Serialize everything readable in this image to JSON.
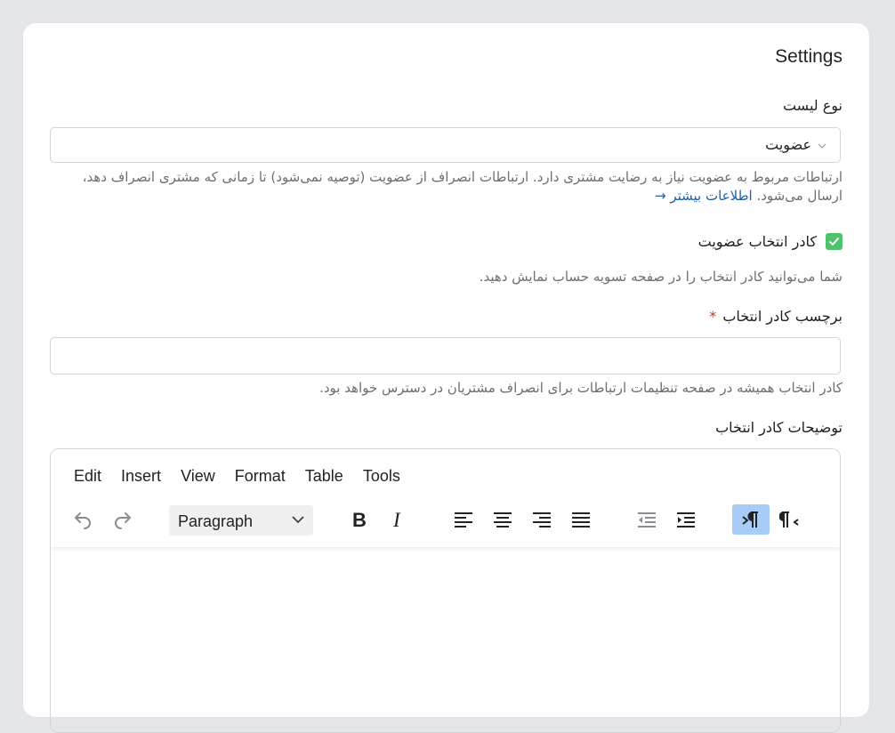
{
  "page": {
    "title": "Settings"
  },
  "list_type": {
    "label": "نوع لیست",
    "selected": "عضویت",
    "help_text": "ارتباطات مربوط به عضویت نیاز به رضایت مشتری دارد. ارتباطات انصراف از عضویت (توصیه نمی‌شود) تا زمانی که مشتری انصراف دهد، ارسال می‌شود.",
    "learn_more": "اطلاعات بیشتر →"
  },
  "opt_in_checkbox": {
    "label": "کادر انتخاب عضویت",
    "checked": true,
    "help_text": "شما می‌توانید کادر انتخاب را در صفحه تسویه حساب نمایش دهید."
  },
  "checkbox_label_field": {
    "label": "برچسب کادر انتخاب",
    "required_mark": "*",
    "value": "",
    "help_text": "کادر انتخاب همیشه در صفحه تنظیمات ارتباطات برای انصراف مشتریان در دسترس خواهد بود."
  },
  "description_field": {
    "label": "توضیحات کادر انتخاب"
  },
  "editor": {
    "menu": [
      "Edit",
      "Insert",
      "View",
      "Format",
      "Table",
      "Tools"
    ],
    "block_format": "Paragraph",
    "icons": {
      "undo": "undo-icon",
      "redo": "redo-icon",
      "bold": "bold-icon",
      "italic": "italic-icon",
      "align_left": "align-left-icon",
      "align_center": "align-center-icon",
      "align_right": "align-right-icon",
      "justify": "justify-icon",
      "outdent": "outdent-icon",
      "indent": "indent-icon",
      "ltr": "ltr-icon",
      "rtl": "rtl-icon"
    },
    "active_direction": "ltr"
  },
  "colors": {
    "checkbox": "#4fc26b",
    "link": "#1f5ea8",
    "active_button": "#a6ccf7",
    "required": "#c0392b"
  }
}
